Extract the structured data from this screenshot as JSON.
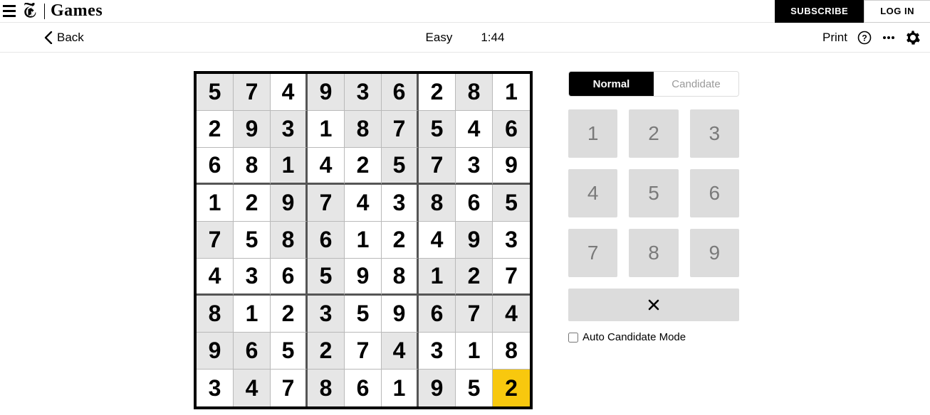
{
  "header": {
    "brand": "Games",
    "subscribe": "SUBSCRIBE",
    "login": "LOG IN"
  },
  "toolbar": {
    "back": "Back",
    "difficulty": "Easy",
    "timer": "1:44",
    "print": "Print"
  },
  "panel": {
    "mode_normal": "Normal",
    "mode_candidate": "Candidate",
    "keys": [
      "1",
      "2",
      "3",
      "4",
      "5",
      "6",
      "7",
      "8",
      "9"
    ],
    "erase_glyph": "✕",
    "auto_label": "Auto Candidate Mode",
    "auto_checked": false
  },
  "sudoku": {
    "selected": [
      8,
      8
    ],
    "rows": [
      [
        {
          "v": "5",
          "g": true
        },
        {
          "v": "7",
          "g": true
        },
        {
          "v": "4",
          "g": false
        },
        {
          "v": "9",
          "g": true
        },
        {
          "v": "3",
          "g": true
        },
        {
          "v": "6",
          "g": true
        },
        {
          "v": "2",
          "g": false
        },
        {
          "v": "8",
          "g": true
        },
        {
          "v": "1",
          "g": false
        }
      ],
      [
        {
          "v": "2",
          "g": false
        },
        {
          "v": "9",
          "g": true
        },
        {
          "v": "3",
          "g": true
        },
        {
          "v": "1",
          "g": false
        },
        {
          "v": "8",
          "g": true
        },
        {
          "v": "7",
          "g": true
        },
        {
          "v": "5",
          "g": true
        },
        {
          "v": "4",
          "g": false
        },
        {
          "v": "6",
          "g": true
        }
      ],
      [
        {
          "v": "6",
          "g": false
        },
        {
          "v": "8",
          "g": false
        },
        {
          "v": "1",
          "g": true
        },
        {
          "v": "4",
          "g": false
        },
        {
          "v": "2",
          "g": false
        },
        {
          "v": "5",
          "g": true
        },
        {
          "v": "7",
          "g": true
        },
        {
          "v": "3",
          "g": false
        },
        {
          "v": "9",
          "g": false
        }
      ],
      [
        {
          "v": "1",
          "g": false
        },
        {
          "v": "2",
          "g": false
        },
        {
          "v": "9",
          "g": true
        },
        {
          "v": "7",
          "g": true
        },
        {
          "v": "4",
          "g": false
        },
        {
          "v": "3",
          "g": false
        },
        {
          "v": "8",
          "g": true
        },
        {
          "v": "6",
          "g": false
        },
        {
          "v": "5",
          "g": true
        }
      ],
      [
        {
          "v": "7",
          "g": true
        },
        {
          "v": "5",
          "g": false
        },
        {
          "v": "8",
          "g": true
        },
        {
          "v": "6",
          "g": true
        },
        {
          "v": "1",
          "g": false
        },
        {
          "v": "2",
          "g": false
        },
        {
          "v": "4",
          "g": false
        },
        {
          "v": "9",
          "g": true
        },
        {
          "v": "3",
          "g": false
        }
      ],
      [
        {
          "v": "4",
          "g": false
        },
        {
          "v": "3",
          "g": false
        },
        {
          "v": "6",
          "g": false
        },
        {
          "v": "5",
          "g": true
        },
        {
          "v": "9",
          "g": false
        },
        {
          "v": "8",
          "g": false
        },
        {
          "v": "1",
          "g": true
        },
        {
          "v": "2",
          "g": true
        },
        {
          "v": "7",
          "g": false
        }
      ],
      [
        {
          "v": "8",
          "g": true
        },
        {
          "v": "1",
          "g": false
        },
        {
          "v": "2",
          "g": false
        },
        {
          "v": "3",
          "g": true
        },
        {
          "v": "5",
          "g": false
        },
        {
          "v": "9",
          "g": false
        },
        {
          "v": "6",
          "g": true
        },
        {
          "v": "7",
          "g": true
        },
        {
          "v": "4",
          "g": true
        }
      ],
      [
        {
          "v": "9",
          "g": true
        },
        {
          "v": "6",
          "g": true
        },
        {
          "v": "5",
          "g": false
        },
        {
          "v": "2",
          "g": true
        },
        {
          "v": "7",
          "g": false
        },
        {
          "v": "4",
          "g": true
        },
        {
          "v": "3",
          "g": false
        },
        {
          "v": "1",
          "g": false
        },
        {
          "v": "8",
          "g": false
        }
      ],
      [
        {
          "v": "3",
          "g": false
        },
        {
          "v": "4",
          "g": true
        },
        {
          "v": "7",
          "g": false
        },
        {
          "v": "8",
          "g": true
        },
        {
          "v": "6",
          "g": false
        },
        {
          "v": "1",
          "g": false
        },
        {
          "v": "9",
          "g": true
        },
        {
          "v": "5",
          "g": false
        },
        {
          "v": "2",
          "g": false
        }
      ]
    ]
  }
}
